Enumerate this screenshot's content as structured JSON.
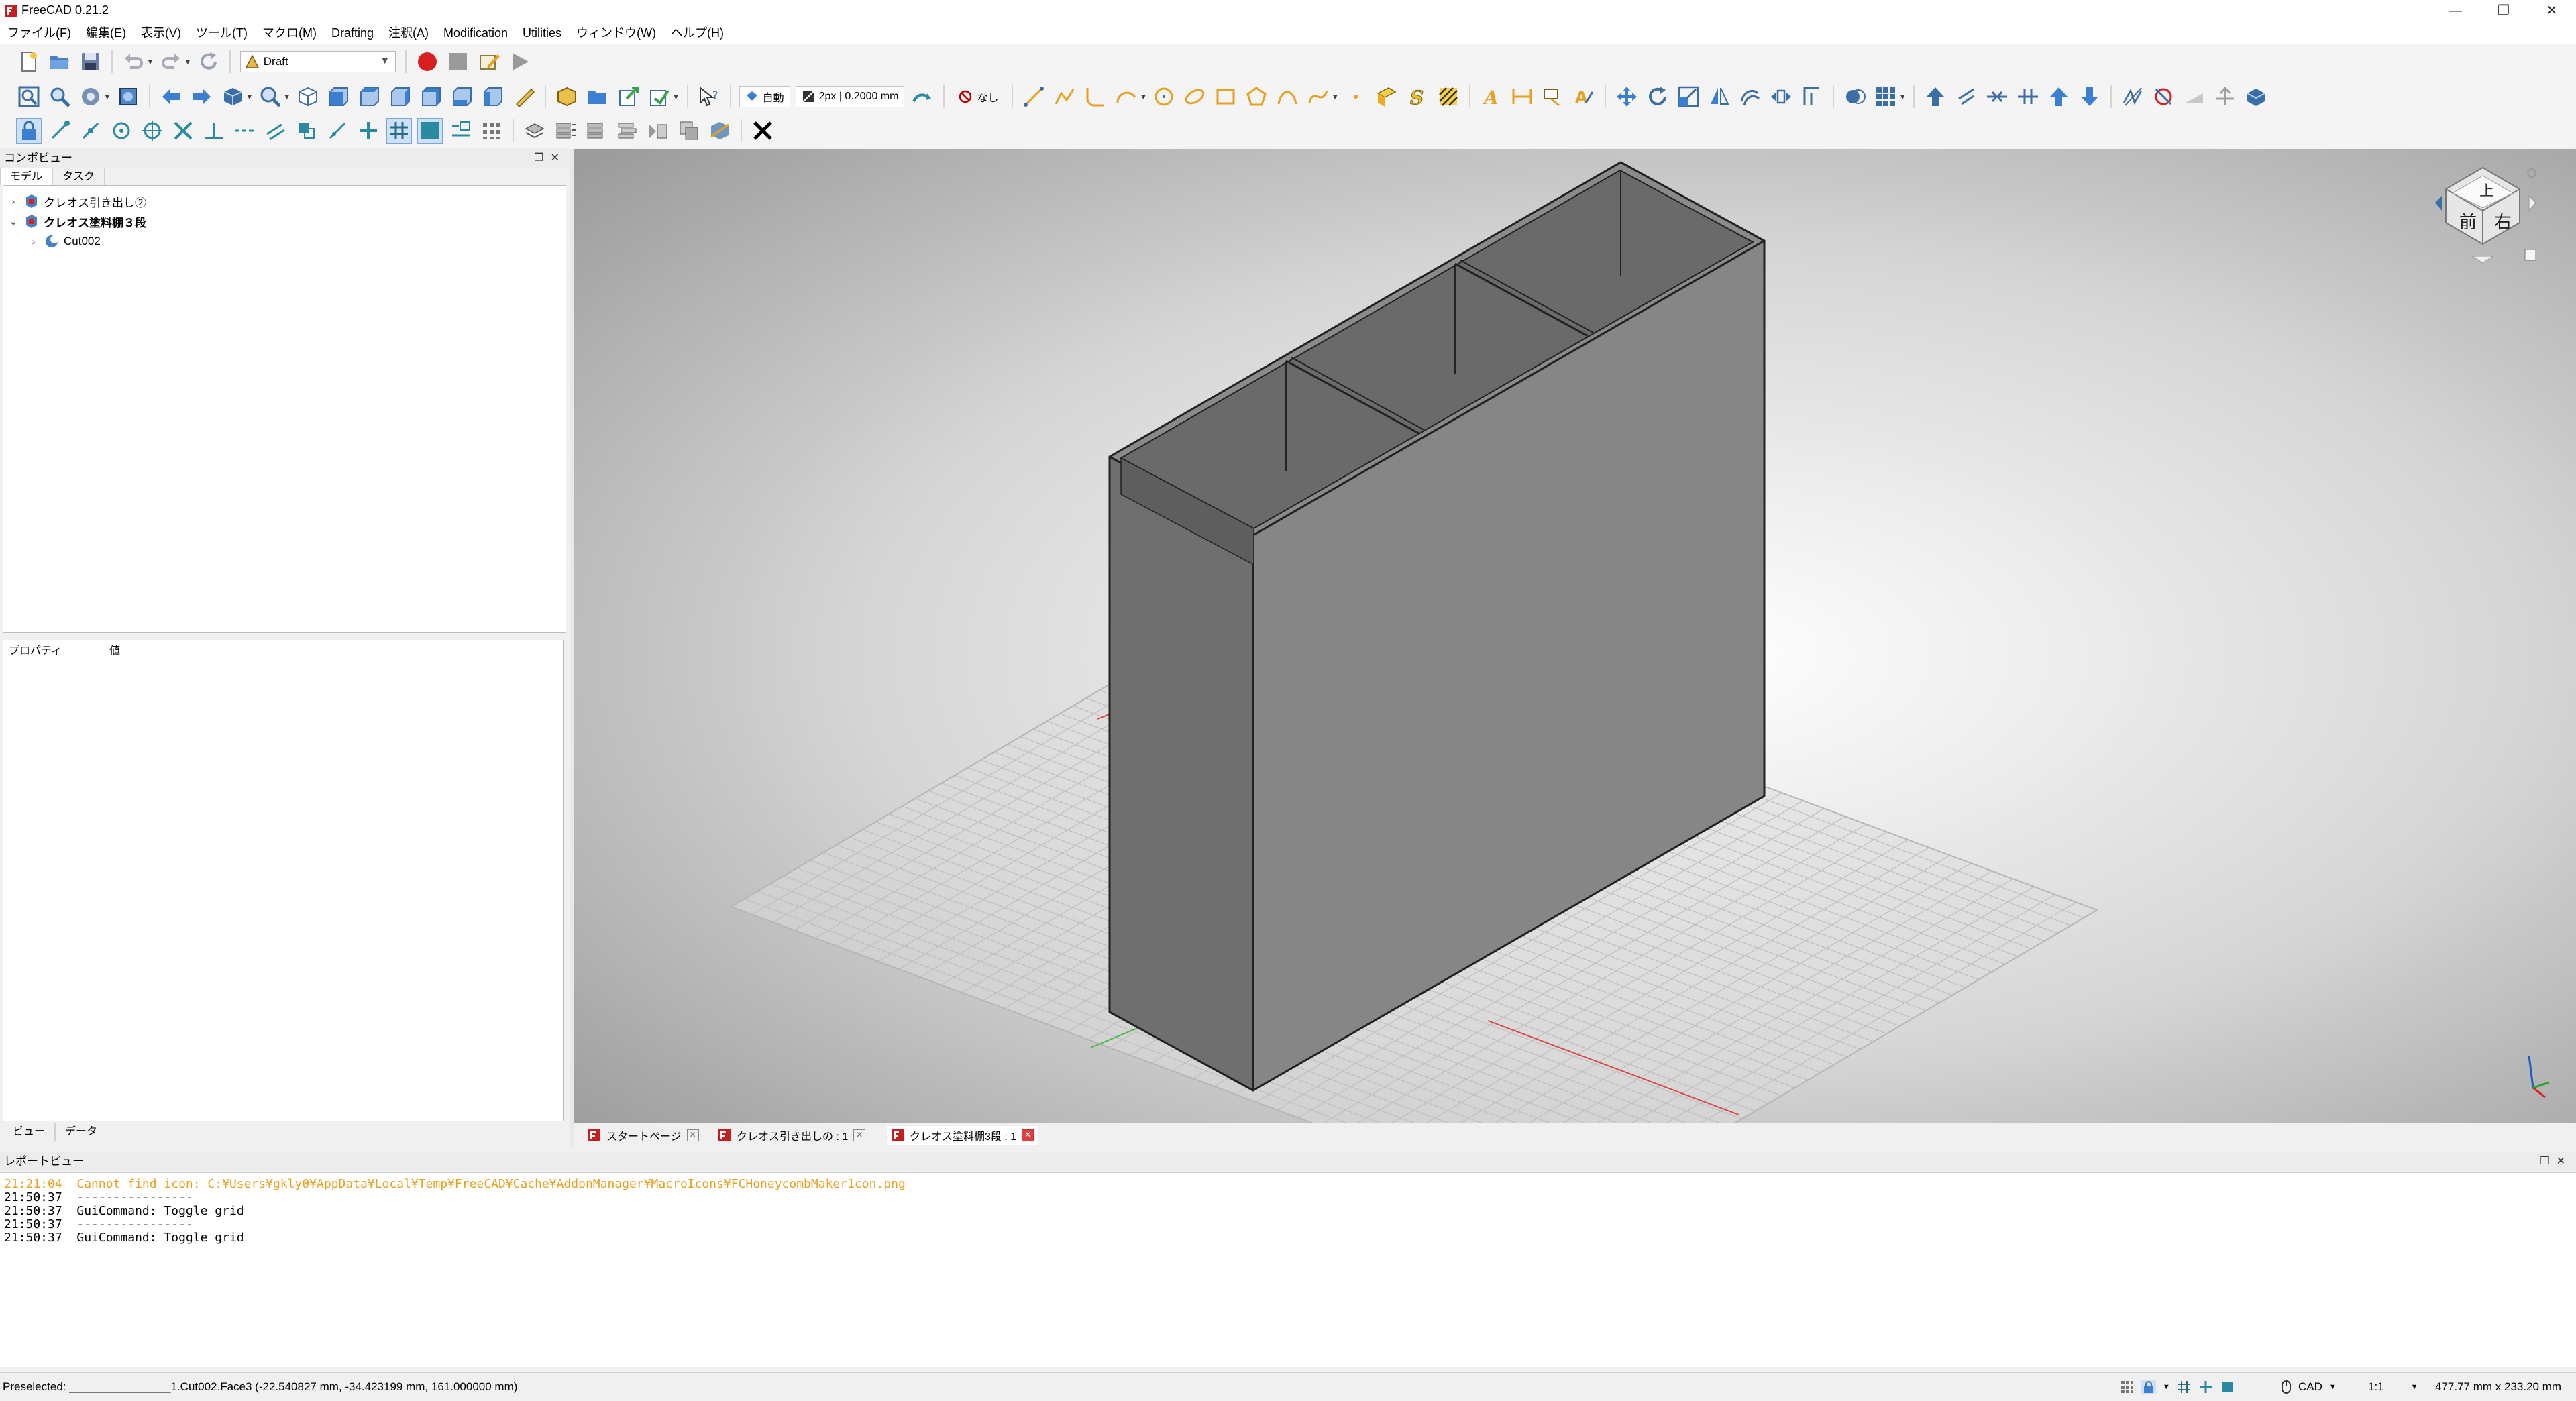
{
  "app": {
    "title": "FreeCAD 0.21.2",
    "menus": [
      "ファイル(F)",
      "編集(E)",
      "表示(V)",
      "ツール(T)",
      "マクロ(M)",
      "Drafting",
      "注釈(A)",
      "Modification",
      "Utilities",
      "ウィンドウ(W)",
      "ヘルプ(H)"
    ]
  },
  "toolbar": {
    "workbench": "Draft",
    "auto_label": "自動",
    "line_style": "2px | 0.2000 mm",
    "none_label": "なし"
  },
  "combo": {
    "title": "コンボビュー",
    "tabs": [
      "モデル",
      "タスク"
    ],
    "tree": [
      {
        "label": "クレオス引き出し②",
        "expanded": false,
        "level": 0
      },
      {
        "label": "クレオス塗料棚３段",
        "expanded": true,
        "level": 0,
        "bold": true
      },
      {
        "label": "Cut002",
        "expanded": false,
        "level": 1
      }
    ],
    "props": {
      "col1": "プロパティ",
      "col2": "値"
    },
    "bottom_tabs": [
      "ビュー",
      "データ"
    ]
  },
  "doc_tabs": [
    {
      "label": "スタートページ",
      "active": false
    },
    {
      "label": "クレオス引き出しの : 1",
      "active": false
    },
    {
      "label": "クレオス塗料棚3段 : 1",
      "active": true
    }
  ],
  "navcube": {
    "top_label": "上",
    "front_label": "前",
    "right_label": "右"
  },
  "report": {
    "title": "レポートビュー",
    "lines": [
      {
        "text": "21:21:04  Cannot find icon: C:¥Users¥gkly0¥AppData¥Local¥Temp¥FreeCAD¥Cache¥AddonManager¥MacroIcons¥FCHoneycombMaker1con.png",
        "warn": true
      },
      {
        "text": "21:50:37  ----------------",
        "warn": false
      },
      {
        "text": "21:50:37  GuiCommand: Toggle grid",
        "warn": false
      },
      {
        "text": "21:50:37  ----------------",
        "warn": false
      },
      {
        "text": "21:50:37  GuiCommand: Toggle grid",
        "warn": false
      }
    ]
  },
  "status": {
    "preselect": "Preselected: ________________1.Cut002.Face3 (-22.540827 mm, -34.423199 mm, 161.000000 mm)",
    "nav_style": "CAD",
    "scale": "1:1",
    "dimensions": "477.77 mm x 233.20 mm"
  },
  "colors": {
    "accent_red": "#cc0000",
    "warn": "#e8a020",
    "model_side": "#6f6f6f",
    "model_front": "#858585"
  }
}
